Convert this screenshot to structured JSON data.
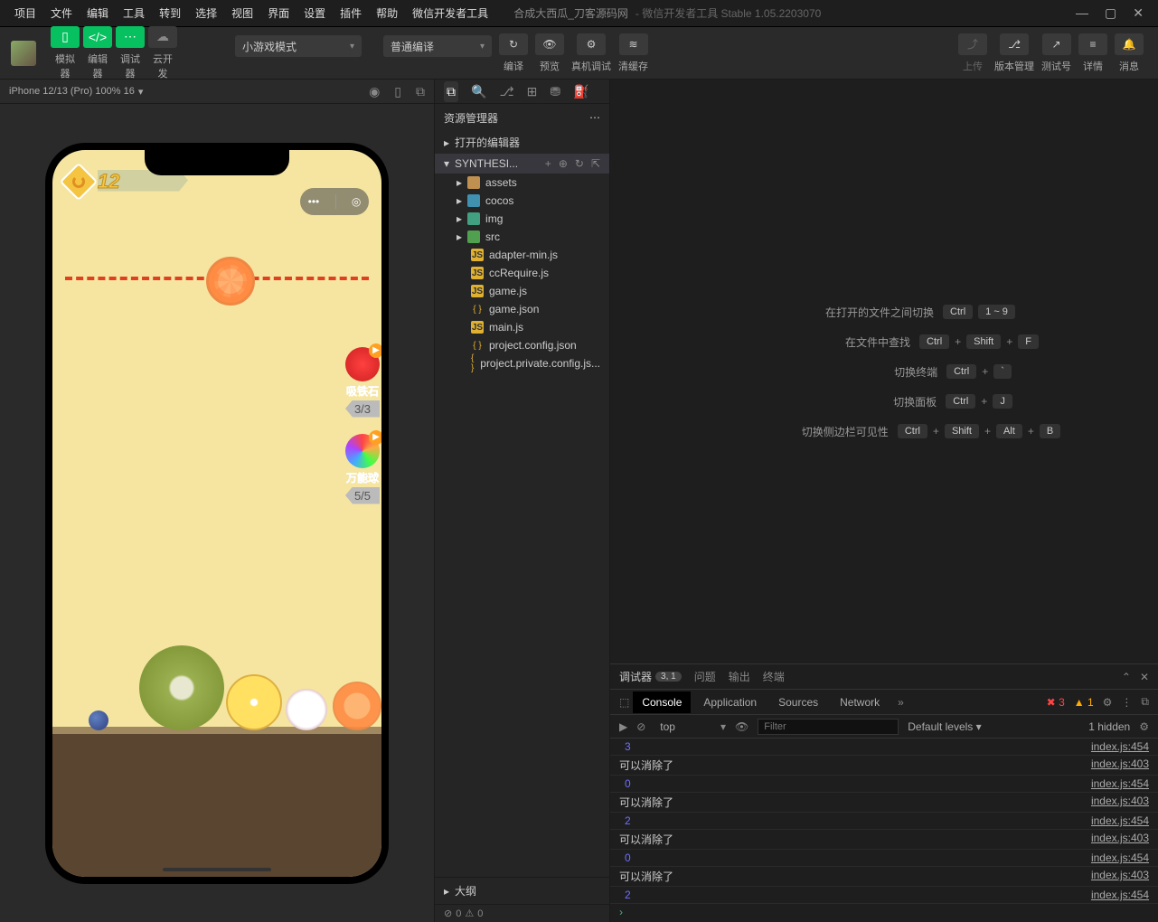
{
  "menu": [
    "项目",
    "文件",
    "编辑",
    "工具",
    "转到",
    "选择",
    "视图",
    "界面",
    "设置",
    "插件",
    "帮助",
    "微信开发者工具"
  ],
  "titlebar": {
    "project": "合成大西瓜_刀客源码网",
    "app": "- 微信开发者工具 Stable 1.05.2203070"
  },
  "toolbar": {
    "sim": "模拟器",
    "editor": "编辑器",
    "debugger": "调试器",
    "cloud": "云开发",
    "mode": "小游戏模式",
    "compile": "普通编译",
    "compile_btn": "编译",
    "preview": "预览",
    "remote": "真机调试",
    "cache": "清缓存",
    "upload": "上传",
    "version": "版本管理",
    "testnum": "测试号",
    "detail": "详情",
    "message": "消息"
  },
  "sim_header": {
    "device": "iPhone 12/13 (Pro) 100% 16"
  },
  "game": {
    "score": "12",
    "powerup1": {
      "label": "吸铁石",
      "count": "3/3"
    },
    "powerup2": {
      "label": "万能球",
      "count": "5/5"
    }
  },
  "explorer": {
    "title": "资源管理器",
    "opened": "打开的编辑器",
    "project": "SYNTHESI...",
    "folders": [
      "assets",
      "cocos",
      "img",
      "src"
    ],
    "files": [
      "adapter-min.js",
      "ccRequire.js",
      "game.js",
      "game.json",
      "main.js",
      "project.config.json",
      "project.private.config.js..."
    ],
    "outline": "大纲",
    "status": {
      "err": "0",
      "warn": "0"
    }
  },
  "shortcuts": [
    {
      "label": "在打开的文件之间切换",
      "keys": [
        "Ctrl",
        "1 ~ 9"
      ]
    },
    {
      "label": "在文件中查找",
      "keys": [
        "Ctrl",
        "+",
        "Shift",
        "+",
        "F"
      ]
    },
    {
      "label": "切换终端",
      "keys": [
        "Ctrl",
        "+",
        "`"
      ]
    },
    {
      "label": "切换面板",
      "keys": [
        "Ctrl",
        "+",
        "J"
      ]
    },
    {
      "label": "切换侧边栏可见性",
      "keys": [
        "Ctrl",
        "+",
        "Shift",
        "+",
        "Alt",
        "+",
        "B"
      ]
    }
  ],
  "debugger": {
    "tab": "调试器",
    "badge": "3, 1",
    "tabs": [
      "问题",
      "输出",
      "终端"
    ],
    "devtabs": [
      "Console",
      "Application",
      "Sources",
      "Network"
    ],
    "stats": {
      "err": "3",
      "warn": "1"
    },
    "filter_top": "top",
    "filter_ph": "Filter",
    "levels": "Default levels",
    "hidden": "1 hidden",
    "logs": [
      {
        "msg": "3",
        "num": true,
        "src": "index.js:454"
      },
      {
        "msg": "可以消除了",
        "src": "index.js:403"
      },
      {
        "msg": "0",
        "num": true,
        "src": "index.js:454"
      },
      {
        "msg": "可以消除了",
        "src": "index.js:403"
      },
      {
        "msg": "2",
        "num": true,
        "src": "index.js:454"
      },
      {
        "msg": "可以消除了",
        "src": "index.js:403"
      },
      {
        "msg": "0",
        "num": true,
        "src": "index.js:454"
      },
      {
        "msg": "可以消除了",
        "src": "index.js:403"
      },
      {
        "msg": "2",
        "num": true,
        "src": "index.js:454"
      }
    ]
  }
}
